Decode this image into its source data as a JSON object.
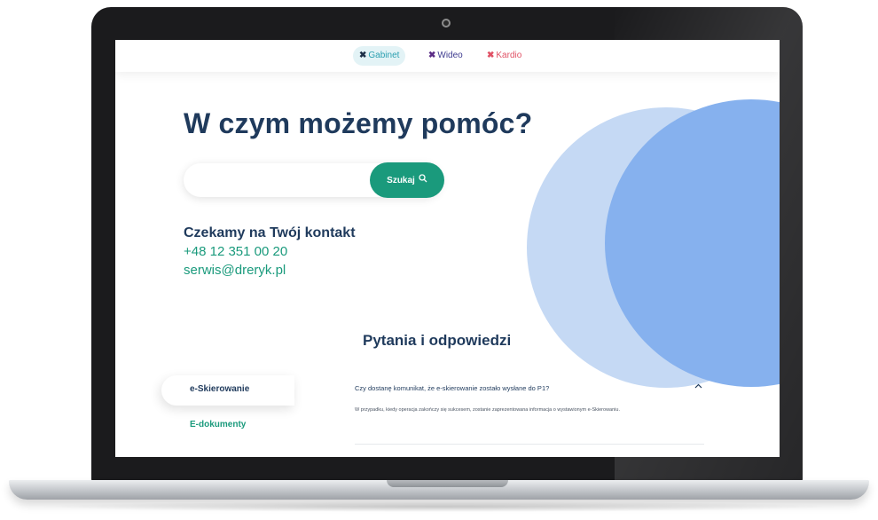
{
  "nav": {
    "tabs": [
      {
        "label": "Gabinet"
      },
      {
        "label": "Wideo"
      },
      {
        "label": "Kardio"
      }
    ],
    "icon_char": "✖"
  },
  "hero": {
    "headline": "W czym możemy pomóc?"
  },
  "search": {
    "placeholder": "",
    "button_label": "Szukaj",
    "icon": "search-icon"
  },
  "contact": {
    "title": "Czekamy na Twój kontakt",
    "phone": "+48 12 351 00 20",
    "email": "serwis@dreryk.pl"
  },
  "faq": {
    "title": "Pytania i odpowiedzi",
    "categories": [
      {
        "label": "e-Skierowanie",
        "active": true
      },
      {
        "label": "E-dokumenty",
        "active": false
      }
    ],
    "items": [
      {
        "question": "Czy dostanę komunikat, że e-skierowanie zostało wysłane do P1?",
        "answer": "W przypadku, kiedy operacja zakończy się sukcesem, zostanie zaprezentowana informacja o wystawionym e-Skierowaniu.",
        "expanded": true
      }
    ]
  },
  "colors": {
    "brand_green": "#1a9a7c",
    "navy": "#1f3a5c",
    "circle_light": "#c5d9f4",
    "circle_dark": "#86b1ee"
  }
}
